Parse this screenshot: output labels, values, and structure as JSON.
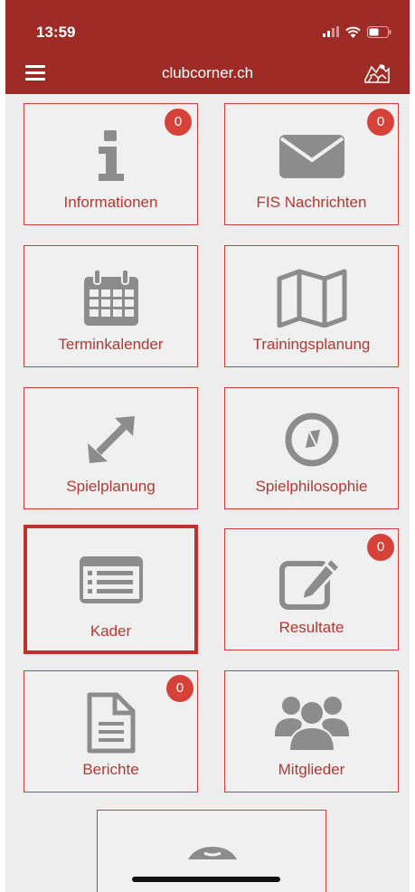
{
  "status_bar": {
    "time": "13:59"
  },
  "header": {
    "title": "clubcorner.ch"
  },
  "tiles": [
    {
      "label": "Informationen",
      "icon": "info-icon",
      "badge": "0"
    },
    {
      "label": "FIS Nachrichten",
      "icon": "envelope-icon",
      "badge": "0"
    },
    {
      "label": "Terminkalender",
      "icon": "calendar-icon"
    },
    {
      "label": "Trainingsplanung",
      "icon": "map-icon"
    },
    {
      "label": "Spielplanung",
      "icon": "expand-arrows-icon"
    },
    {
      "label": "Spielphilosophie",
      "icon": "compass-icon"
    },
    {
      "label": "Kader",
      "icon": "list-card-icon",
      "selected": true
    },
    {
      "label": "Resultate",
      "icon": "edit-icon",
      "badge": "0"
    },
    {
      "label": "Berichte",
      "icon": "document-icon",
      "badge": "0"
    },
    {
      "label": "Mitglieder",
      "icon": "users-icon"
    }
  ],
  "colors": {
    "brand": "#9e2b25",
    "accent": "#c9413a",
    "badge": "#d6423a",
    "icon": "#8c8c8c"
  }
}
